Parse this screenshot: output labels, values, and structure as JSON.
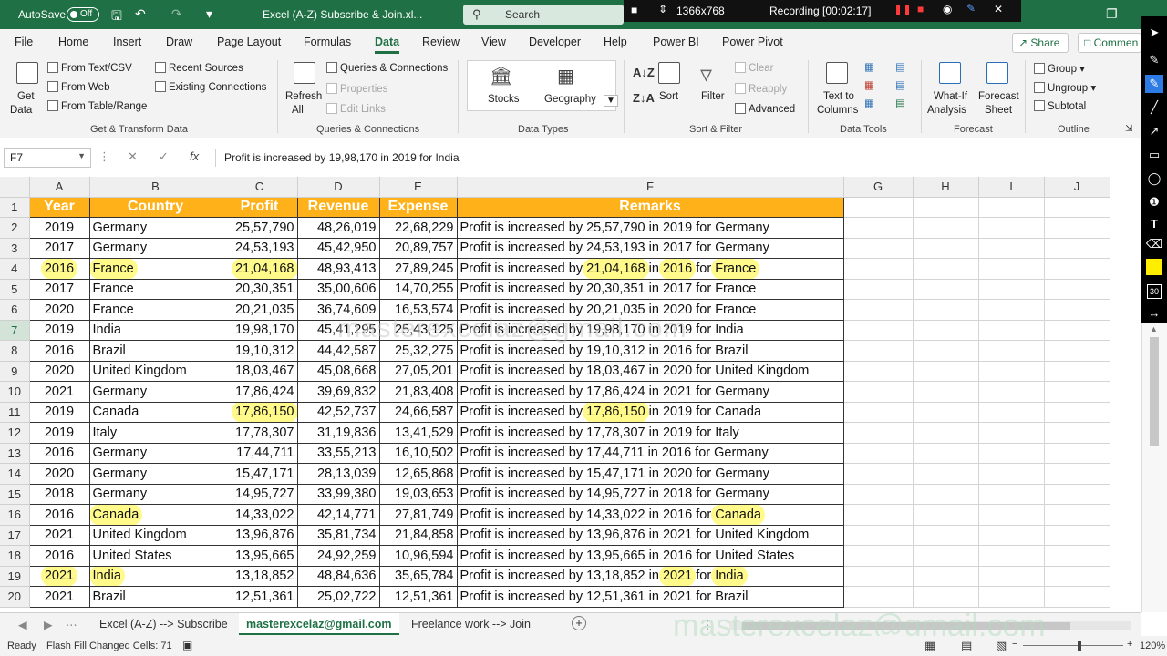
{
  "titlebar": {
    "autosave_label": "AutoSave",
    "autosave_state": "Off",
    "filename": "Excel (A-Z) Subscribe & Join.xl...",
    "search_placeholder": "Search",
    "resolution": "1366x768",
    "recording": "Recording [00:02:17]"
  },
  "menu": {
    "tabs": [
      "File",
      "Home",
      "Insert",
      "Draw",
      "Page Layout",
      "Formulas",
      "Data",
      "Review",
      "View",
      "Developer",
      "Help",
      "Power BI",
      "Power Pivot"
    ],
    "active": "Data",
    "share": "Share",
    "comments": "Commen"
  },
  "ribbon": {
    "get_data": "Get",
    "get_data2": "Data",
    "from_text_csv": "From Text/CSV",
    "from_web": "From Web",
    "from_table": "From Table/Range",
    "recent_sources": "Recent Sources",
    "existing_connections": "Existing Connections",
    "group_get_transform": "Get & Transform Data",
    "refresh": "Refresh",
    "refresh_all": "All",
    "queries_connections": "Queries & Connections",
    "properties": "Properties",
    "edit_links": "Edit Links",
    "group_queries": "Queries & Connections",
    "stocks": "Stocks",
    "geography": "Geography",
    "group_data_types": "Data Types",
    "sort": "Sort",
    "filter": "Filter",
    "clear": "Clear",
    "reapply": "Reapply",
    "advanced": "Advanced",
    "group_sort_filter": "Sort & Filter",
    "text_to": "Text to",
    "columns": "Columns",
    "group_data_tools": "Data Tools",
    "what_if": "What-If",
    "analysis": "Analysis",
    "forecast": "Forecast",
    "sheet": "Sheet",
    "group_forecast": "Forecast",
    "group": "Group",
    "ungroup": "Ungroup",
    "subtotal": "Subtotal",
    "group_outline": "Outline"
  },
  "formula_bar": {
    "name_box": "F7",
    "fx": "fx",
    "formula": "Profit is increased by 19,98,170 in 2019 for India"
  },
  "grid": {
    "columns": [
      "A",
      "B",
      "C",
      "D",
      "E",
      "F",
      "G",
      "H",
      "I",
      "J"
    ],
    "selected_column": "F",
    "selected_row": 7,
    "headers": [
      "Year",
      "Country",
      "Profit",
      "Revenue",
      "Expense",
      "Remarks"
    ],
    "rows": [
      [
        "2019",
        "Germany",
        "25,57,790",
        "48,26,019",
        "22,68,229",
        "Profit is increased by 25,57,790 in 2019 for Germany"
      ],
      [
        "2017",
        "Germany",
        "24,53,193",
        "45,42,950",
        "20,89,757",
        "Profit is increased by 24,53,193 in 2017 for Germany"
      ],
      [
        "2016",
        "France",
        "21,04,168",
        "48,93,413",
        "27,89,245",
        "Profit is increased by 21,04,168 in 2016 for France"
      ],
      [
        "2017",
        "France",
        "20,30,351",
        "35,00,606",
        "14,70,255",
        "Profit is increased by 20,30,351 in 2017 for France"
      ],
      [
        "2020",
        "France",
        "20,21,035",
        "36,74,609",
        "16,53,574",
        "Profit is increased by 20,21,035 in 2020 for France"
      ],
      [
        "2019",
        "India",
        "19,98,170",
        "45,41,295",
        "25,43,125",
        "Profit is increased by 19,98,170 in 2019 for India"
      ],
      [
        "2016",
        "Brazil",
        "19,10,312",
        "44,42,587",
        "25,32,275",
        "Profit is increased by 19,10,312 in 2016 for Brazil"
      ],
      [
        "2020",
        "United Kingdom",
        "18,03,467",
        "45,08,668",
        "27,05,201",
        "Profit is increased by 18,03,467 in 2020 for United Kingdom"
      ],
      [
        "2021",
        "Germany",
        "17,86,424",
        "39,69,832",
        "21,83,408",
        "Profit is increased by 17,86,424 in 2021 for Germany"
      ],
      [
        "2019",
        "Canada",
        "17,86,150",
        "42,52,737",
        "24,66,587",
        "Profit is increased by 17,86,150 in 2019 for Canada"
      ],
      [
        "2019",
        "Italy",
        "17,78,307",
        "31,19,836",
        "13,41,529",
        "Profit is increased by 17,78,307 in 2019 for Italy"
      ],
      [
        "2016",
        "Germany",
        "17,44,711",
        "33,55,213",
        "16,10,502",
        "Profit is increased by 17,44,711 in 2016 for Germany"
      ],
      [
        "2020",
        "Germany",
        "15,47,171",
        "28,13,039",
        "12,65,868",
        "Profit is increased by 15,47,171 in 2020 for Germany"
      ],
      [
        "2018",
        "Germany",
        "14,95,727",
        "33,99,380",
        "19,03,653",
        "Profit is increased by 14,95,727 in 2018 for Germany"
      ],
      [
        "2016",
        "Canada",
        "14,33,022",
        "42,14,771",
        "27,81,749",
        "Profit is increased by 14,33,022 in 2016 for Canada"
      ],
      [
        "2021",
        "United Kingdom",
        "13,96,876",
        "35,81,734",
        "21,84,858",
        "Profit is increased by 13,96,876 in 2021 for United Kingdom"
      ],
      [
        "2016",
        "United States",
        "13,95,665",
        "24,92,259",
        "10,96,594",
        "Profit is increased by 13,95,665 in 2016 for United States"
      ],
      [
        "2021",
        "India",
        "13,18,852",
        "48,84,636",
        "35,65,784",
        "Profit is increased by 13,18,852 in 2021 for India"
      ],
      [
        "2021",
        "Brazil",
        "12,51,361",
        "25,02,722",
        "12,51,361",
        "Profit is increased by 12,51,361 in 2021 for Brazil"
      ]
    ]
  },
  "watermark": "masterexcelaz@gmail.com",
  "sheets": {
    "tabs": [
      "Excel (A-Z) --> Subscribe",
      "masterexcelaz@gmail.com",
      "Freelance work --> Join"
    ],
    "active": "masterexcelaz@gmail.com",
    "add": "+"
  },
  "status": {
    "ready": "Ready",
    "flash_fill": "Flash Fill Changed Cells: 71",
    "zoom": "120%"
  },
  "colors": {
    "excel_green": "#1f7145",
    "header_orange": "#ffb11a",
    "highlight_yellow": "#fffa8a"
  }
}
